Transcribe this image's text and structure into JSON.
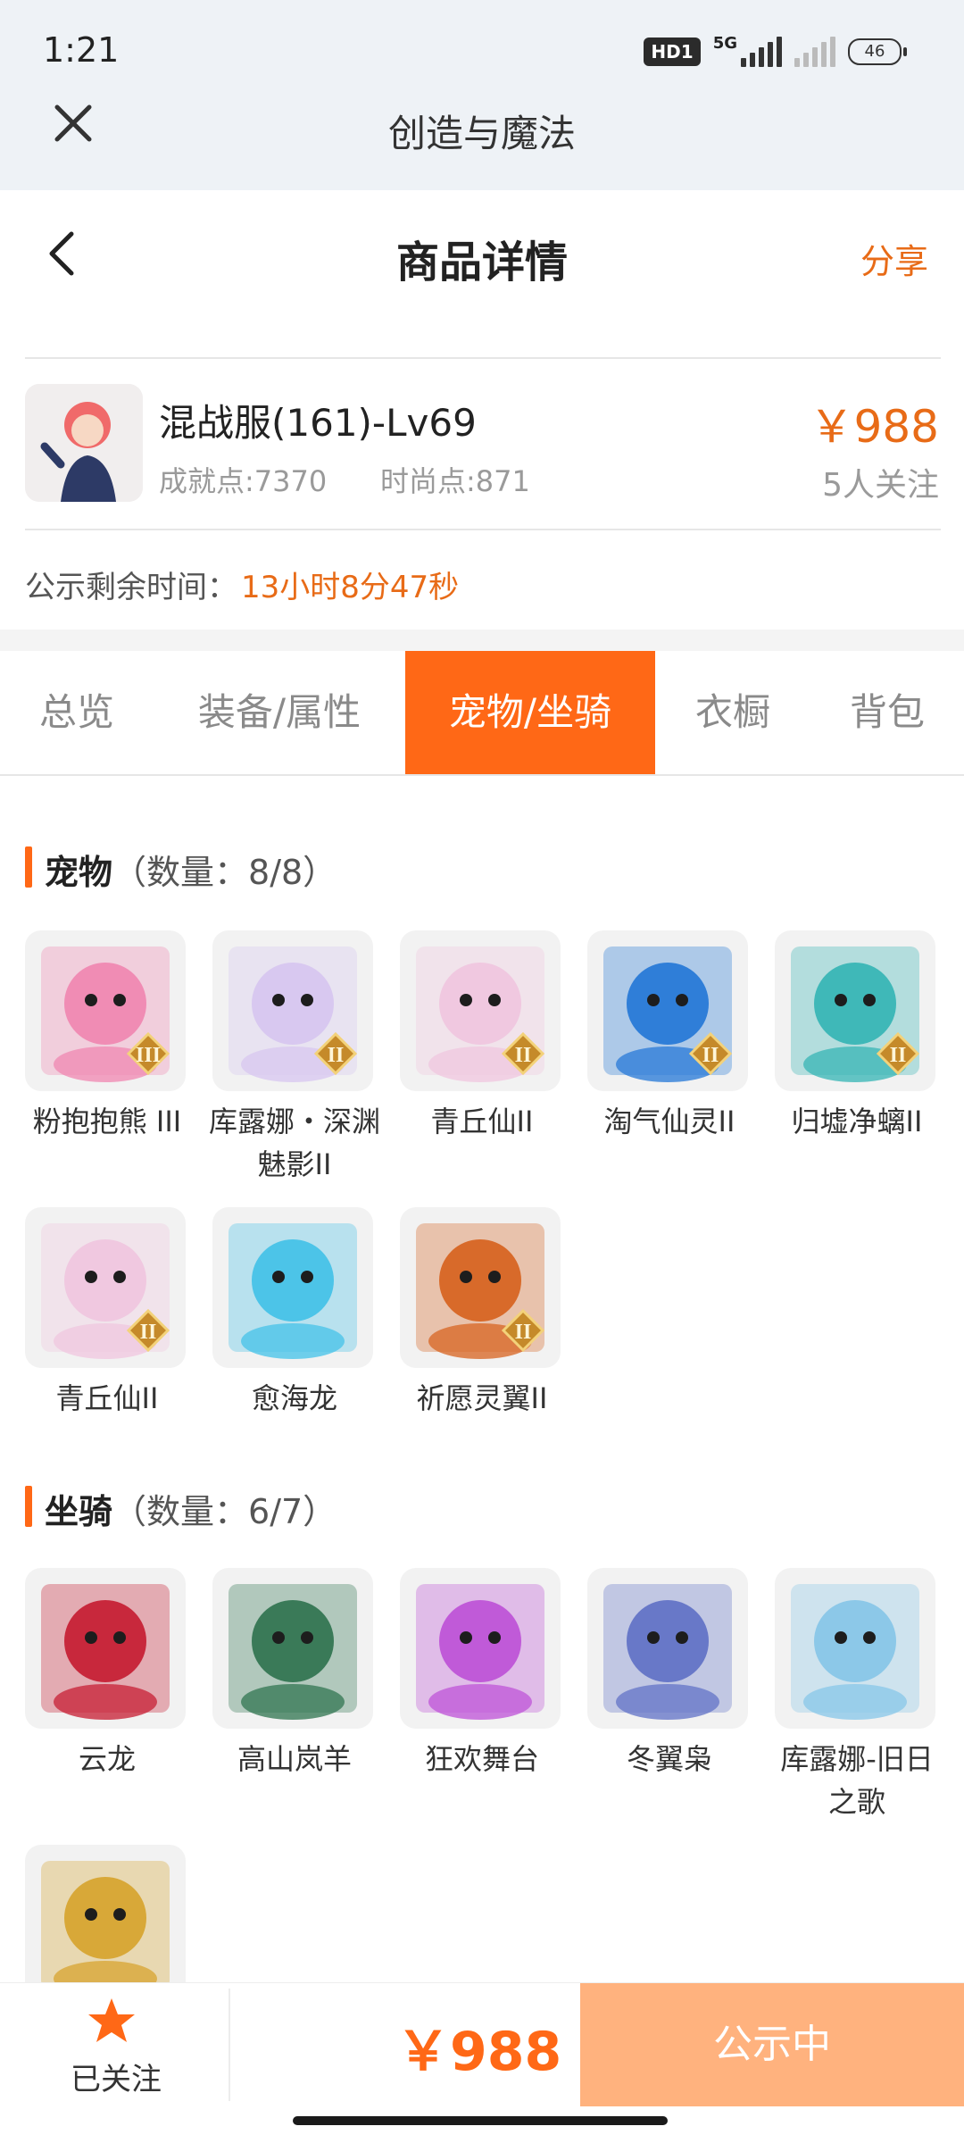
{
  "status_bar": {
    "time": "1:21",
    "hd": "HD1",
    "network": "5G",
    "battery": "46"
  },
  "app_bar": {
    "title": "创造与魔法",
    "close_icon": "close-icon"
  },
  "header": {
    "title": "商品详情",
    "share": "分享",
    "back_icon": "chevron-left-icon"
  },
  "product": {
    "name": "混战服(161)-Lv69",
    "achievement": "成就点:7370",
    "fashion": "时尚点:871",
    "price": "￥988",
    "followers": "5人关注"
  },
  "timer": {
    "label": "公示剩余时间：",
    "value": "13小时8分47秒"
  },
  "tabs": [
    "总览",
    "装备/属性",
    "宠物/坐骑",
    "衣橱",
    "背包"
  ],
  "active_tab": 2,
  "pets": {
    "title": "宠物",
    "count": "（数量：8/8）",
    "items": [
      {
        "name": "粉抱抱熊 III",
        "badge": "III",
        "color": "#f08cb4"
      },
      {
        "name": "库露娜・深渊魅影II",
        "badge": "II",
        "color": "#d8c8f0"
      },
      {
        "name": "青丘仙II",
        "badge": "II",
        "color": "#f0c8e0"
      },
      {
        "name": "淘气仙灵II",
        "badge": "II",
        "color": "#2f7ed8"
      },
      {
        "name": "归墟净螭II",
        "badge": "II",
        "color": "#3fb8b8"
      },
      {
        "name": "青丘仙II",
        "badge": "II",
        "color": "#f0c8e0"
      },
      {
        "name": "愈海龙",
        "badge": "",
        "color": "#4cc4e8"
      },
      {
        "name": "祈愿灵翼II",
        "badge": "II",
        "color": "#d86a2a"
      }
    ]
  },
  "mounts": {
    "title": "坐骑",
    "count": "（数量：6/7）",
    "items": [
      {
        "name": "云龙",
        "color": "#c8283c"
      },
      {
        "name": "高山岚羊",
        "color": "#3a7a58"
      },
      {
        "name": "狂欢舞台",
        "color": "#c05ad8"
      },
      {
        "name": "冬翼枭",
        "color": "#6878c8"
      },
      {
        "name": "库露娜-旧日之歌",
        "color": "#8cc8e8"
      },
      {
        "name": "",
        "color": "#d8a838"
      }
    ]
  },
  "bottom_bar": {
    "fav_label": "已关注",
    "price": "￥988",
    "button": "公示中"
  },
  "colors": {
    "accent": "#ff6816",
    "price": "#e86b17",
    "button_disabled": "#ffb27e"
  }
}
